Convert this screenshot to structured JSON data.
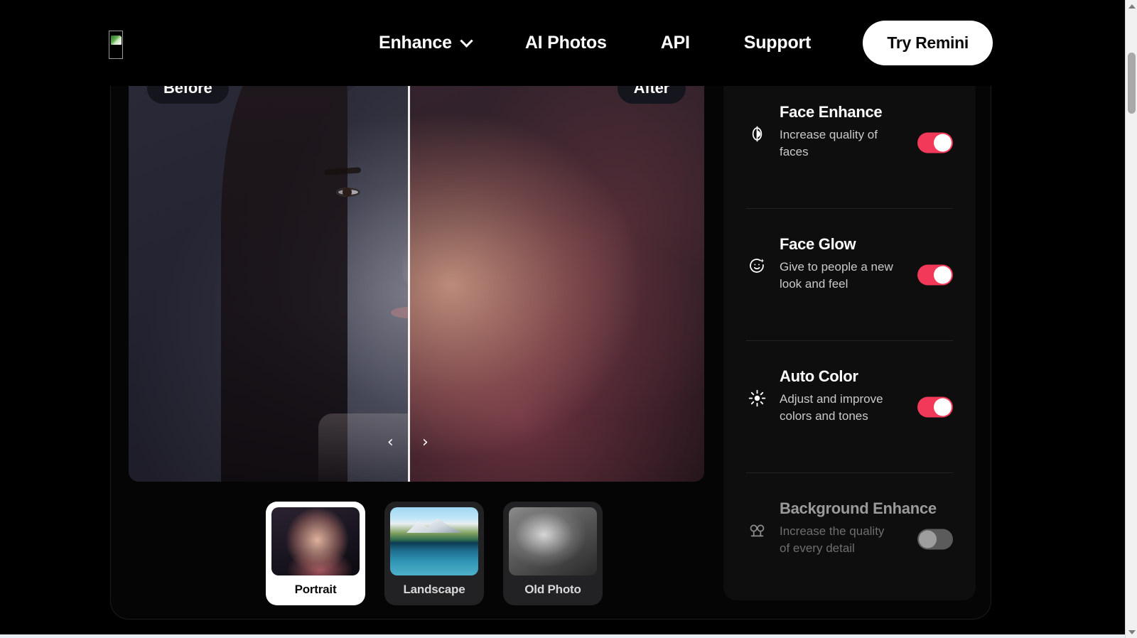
{
  "browser": {
    "scrollbar": {
      "up_arrow_icon": "triangle-up-icon",
      "down_arrow_icon": "triangle-down-icon"
    }
  },
  "header": {
    "logo_icon": "broken-image-logo-icon",
    "nav": [
      {
        "label": "Enhance",
        "has_dropdown": true,
        "icon": "chevron-down-icon"
      },
      {
        "label": "AI Photos",
        "has_dropdown": false
      },
      {
        "label": "API",
        "has_dropdown": false
      },
      {
        "label": "Support",
        "has_dropdown": false
      }
    ],
    "cta_label": "Try Remini"
  },
  "compare": {
    "before_label": "Before",
    "after_label": "After",
    "slider_position_percent": 48.5,
    "handle_left_icon": "chevron-left-icon",
    "handle_right_icon": "chevron-right-icon",
    "handle_left_glyph": "‹",
    "handle_right_glyph": "›"
  },
  "thumbnails": [
    {
      "label": "Portrait",
      "selected": true,
      "image_kind": "ti-portrait"
    },
    {
      "label": "Landscape",
      "selected": false,
      "image_kind": "ti-landscape"
    },
    {
      "label": "Old Photo",
      "selected": false,
      "image_kind": "ti-oldphoto"
    }
  ],
  "settings": [
    {
      "title": "Face Enhance",
      "description": "Increase quality of faces",
      "icon": "face-enhance-icon",
      "enabled": true
    },
    {
      "title": "Face Glow",
      "description": "Give to people a new look and feel",
      "icon": "face-glow-icon",
      "enabled": true
    },
    {
      "title": "Auto Color",
      "description": "Adjust and improve colors and tones",
      "icon": "brightness-sun-icon",
      "enabled": true
    },
    {
      "title": "Background Enhance",
      "description": "Increase the quality of every detail",
      "icon": "trees-icon",
      "enabled": false
    }
  ],
  "colors": {
    "page_background": "#000000",
    "card_background": "#050505",
    "panel_background": "#0e0e0e",
    "toggle_on": "#f2395a",
    "toggle_off": "#5b5b5b",
    "cta_background": "#ffffff",
    "text_primary": "#ffffff",
    "text_secondary": "#c9c9c9"
  }
}
